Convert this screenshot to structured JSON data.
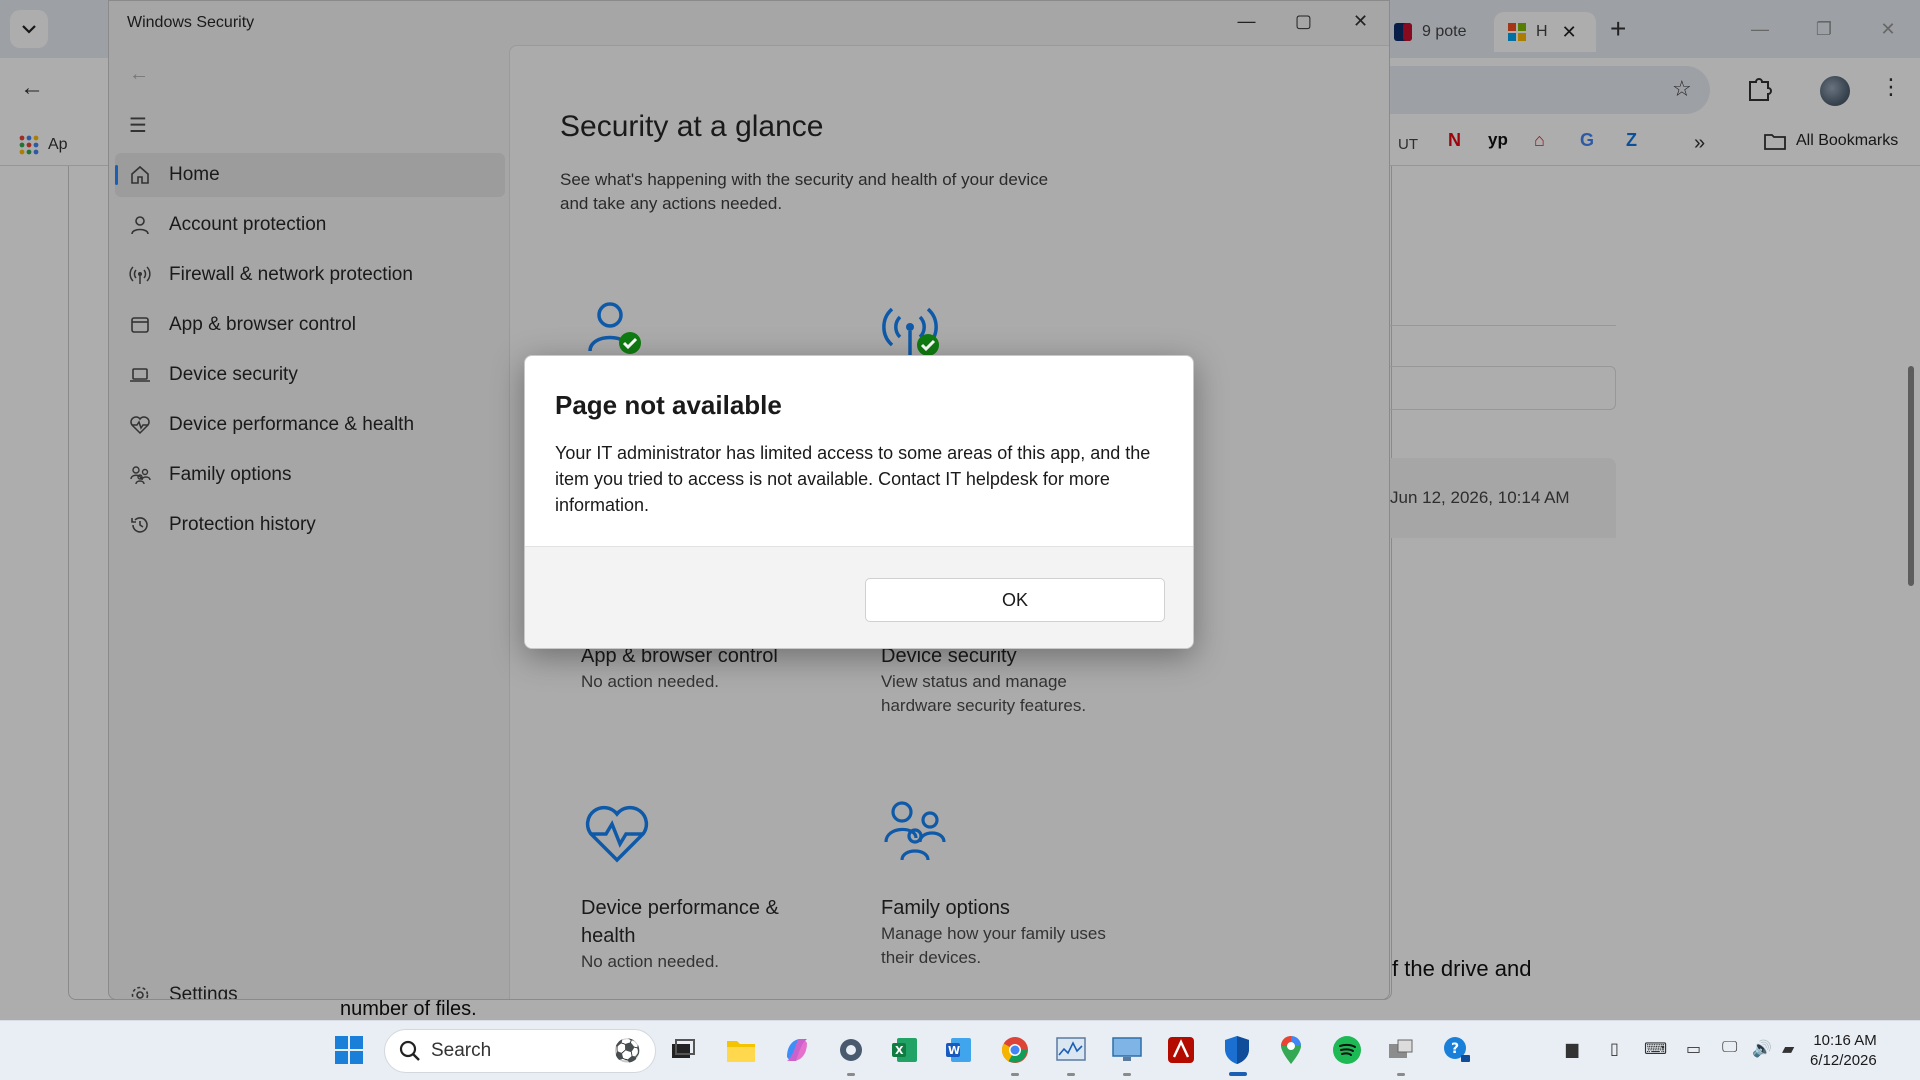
{
  "browser": {
    "tabs": [
      {
        "label": "9 pote",
        "active": false
      },
      {
        "label": "H",
        "active": true
      }
    ],
    "bookmarks": {
      "apps_label": "Ap",
      "items": [
        "UT"
      ],
      "all_label": "All Bookmarks"
    },
    "page": {
      "timestamp": "Jun 12, 2026, 10:14 AM",
      "text_fragment": "f the drive and",
      "behind_text": "number of files."
    }
  },
  "security_window": {
    "title": "Windows Security",
    "nav": {
      "items": [
        {
          "label": "Home",
          "icon": "home-icon",
          "active": true
        },
        {
          "label": "Account protection",
          "icon": "person-icon",
          "active": false
        },
        {
          "label": "Firewall & network protection",
          "icon": "antenna-icon",
          "active": false
        },
        {
          "label": "App & browser control",
          "icon": "window-icon",
          "active": false
        },
        {
          "label": "Device security",
          "icon": "laptop-icon",
          "active": false
        },
        {
          "label": "Device performance & health",
          "icon": "heart-pulse-icon",
          "active": false
        },
        {
          "label": "Family options",
          "icon": "family-icon",
          "active": false
        },
        {
          "label": "Protection history",
          "icon": "history-icon",
          "active": false
        }
      ],
      "settings_label": "Settings"
    },
    "main": {
      "title": "Security at a glance",
      "subtitle": "See what's happening with the security and health of your device and take any actions needed.",
      "tiles": {
        "app_browser": {
          "title": "App & browser control",
          "desc": "No action needed."
        },
        "device_security": {
          "title": "Device security",
          "desc": "View status and manage hardware security features."
        },
        "device_performance": {
          "title": "Device performance & health",
          "desc": "No action needed."
        },
        "family": {
          "title": "Family options",
          "desc": "Manage how your family uses their devices."
        }
      }
    }
  },
  "dialog": {
    "title": "Page not available",
    "message": "Your IT administrator has limited access to some areas of this app, and the item you tried to access is not available. Contact IT helpdesk for more information.",
    "ok_label": "OK"
  },
  "taskbar": {
    "search_placeholder": "Search",
    "time": "10:16 AM",
    "date": "6/12/2026"
  },
  "colors": {
    "accent": "#1a5fb4",
    "status_ok": "#107c10",
    "icon_blue": "#0f5aa8"
  }
}
